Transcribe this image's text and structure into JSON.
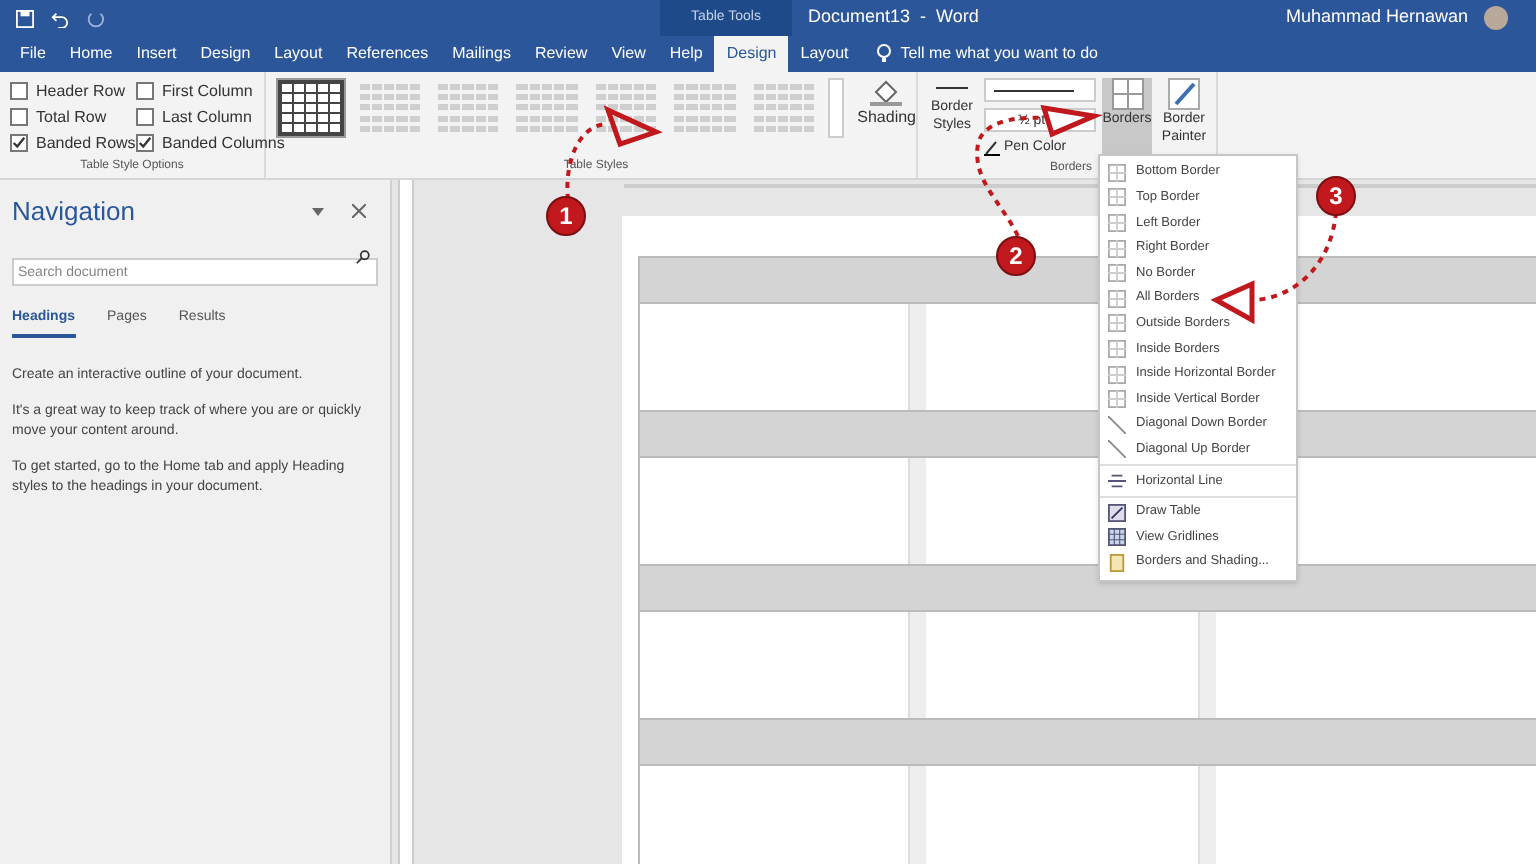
{
  "title_bar": {
    "contextual_label": "Table Tools",
    "title": "Document13  -  Word",
    "user": "Muhammad Hernawan"
  },
  "tabs": [
    {
      "label": "File",
      "selected": false
    },
    {
      "label": "Home",
      "selected": false
    },
    {
      "label": "Insert",
      "selected": false
    },
    {
      "label": "Design",
      "selected": false
    },
    {
      "label": "Layout",
      "selected": false
    },
    {
      "label": "References",
      "selected": false
    },
    {
      "label": "Mailings",
      "selected": false
    },
    {
      "label": "Review",
      "selected": false
    },
    {
      "label": "View",
      "selected": false
    },
    {
      "label": "Help",
      "selected": false
    },
    {
      "label": "Design",
      "selected": true
    },
    {
      "label": "Layout",
      "selected": false
    }
  ],
  "tell_me": {
    "placeholder": "Tell me what you want to do"
  },
  "table_style_options": {
    "label": "Table Style Options",
    "options": [
      {
        "label": "Header Row",
        "checked": false
      },
      {
        "label": "First Column",
        "checked": false
      },
      {
        "label": "Total Row",
        "checked": false
      },
      {
        "label": "Last Column",
        "checked": false
      },
      {
        "label": "Banded Rows",
        "checked": true
      },
      {
        "label": "Banded Columns",
        "checked": true
      }
    ]
  },
  "table_styles": {
    "label": "Table Styles",
    "shading": "Shading"
  },
  "borders_group": {
    "label": "Borders",
    "border_styles": "Border Styles",
    "pen_weight": "½ pt",
    "pen_color": "Pen Color",
    "borders": "Borders",
    "border_painter": "Border Painter"
  },
  "navigation": {
    "title": "Navigation",
    "search": {
      "placeholder": "Search document"
    },
    "tabs": [
      {
        "label": "Headings",
        "selected": true
      },
      {
        "label": "Pages",
        "selected": false
      },
      {
        "label": "Results",
        "selected": false
      }
    ],
    "paragraphs": [
      "Create an interactive outline of your document.",
      "It's a great way to keep track of where you are or quickly move your content around.",
      "To get started, go to the Home tab and apply Heading styles to the headings in your document."
    ]
  },
  "borders_menu": [
    {
      "kind": "border",
      "label": "Bottom Border"
    },
    {
      "kind": "border",
      "label": "Top Border"
    },
    {
      "kind": "border",
      "label": "Left Border"
    },
    {
      "kind": "border",
      "label": "Right Border"
    },
    {
      "kind": "border",
      "label": "No Border"
    },
    {
      "kind": "border",
      "label": "All Borders"
    },
    {
      "kind": "border",
      "label": "Outside Borders"
    },
    {
      "kind": "border",
      "label": "Inside Borders"
    },
    {
      "kind": "border",
      "label": "Inside Horizontal Border"
    },
    {
      "kind": "border",
      "label": "Inside Vertical Border"
    },
    {
      "kind": "diagonal",
      "label": "Diagonal Down Border"
    },
    {
      "kind": "diagonal",
      "label": "Diagonal Up Border"
    },
    {
      "kind": "line",
      "label": "Horizontal Line"
    },
    {
      "kind": "draw",
      "label": "Draw Table"
    },
    {
      "kind": "grid",
      "label": "View Gridlines"
    },
    {
      "kind": "dialog",
      "label": "Borders and Shading..."
    }
  ],
  "step_markers": [
    "1",
    "2",
    "3"
  ]
}
